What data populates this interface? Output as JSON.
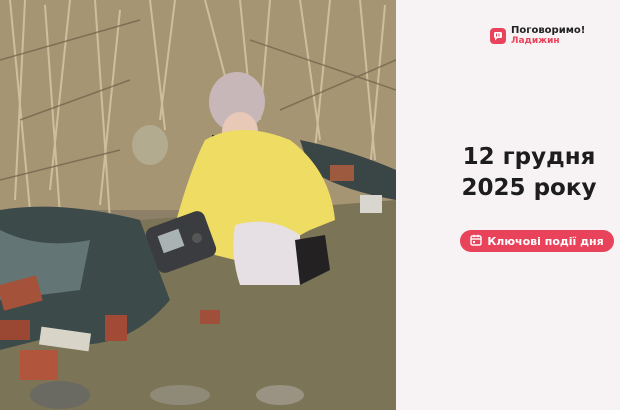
{
  "brand": {
    "name_line1": "Поговоримо!",
    "name_line2": "Ладижин",
    "accent_color": "#e8435a"
  },
  "headline": {
    "date_line1": "12 грудня",
    "date_line2": "2025 року"
  },
  "cta": {
    "label": "Ключові події дня",
    "icon": "calendar-icon"
  },
  "photo": {
    "subject": "woman-with-water-testing-device"
  }
}
